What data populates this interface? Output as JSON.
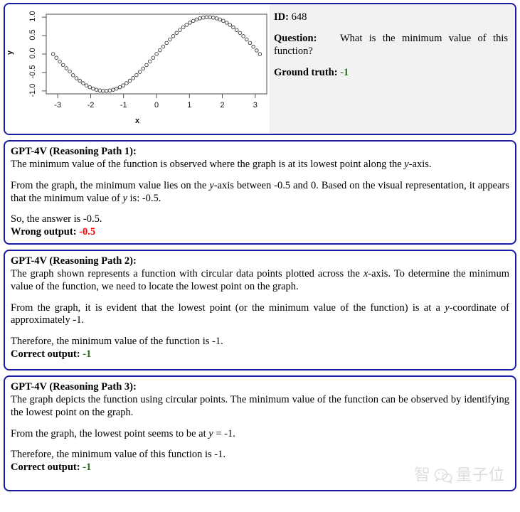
{
  "meta": {
    "id_label": "ID:",
    "id_value": "648",
    "question_label": "Question:",
    "question_text": "What is the minimum value of this function?",
    "ground_truth_label": "Ground truth:",
    "ground_truth_value": "-1",
    "ground_truth_color": "#2a6b18"
  },
  "chart_data": {
    "type": "scatter",
    "title": "",
    "xlabel": "x",
    "ylabel": "y",
    "xlim": [
      -3.35,
      3.35
    ],
    "ylim": [
      -1.08,
      1.08
    ],
    "grid": false,
    "legend": null,
    "marker": "open-circle",
    "xticks": [
      "-3",
      "-2",
      "-1",
      "0",
      "1",
      "2",
      "3"
    ],
    "xtick_values": [
      -3,
      -2,
      -1,
      0,
      1,
      2,
      3
    ],
    "yticks": [
      "1.0",
      "0.5",
      "0.0",
      "-0.5",
      "-1.0"
    ],
    "ytick_values": [
      1.0,
      0.5,
      0.0,
      -0.5,
      -1.0
    ],
    "function": "y = sin(x)",
    "n_points": 63,
    "x": [
      -3.1416,
      -3.0402,
      -2.9388,
      -2.8374,
      -2.736,
      -2.6346,
      -2.5332,
      -2.4318,
      -2.3304,
      -2.229,
      -2.1276,
      -2.0262,
      -1.9248,
      -1.8234,
      -1.722,
      -1.6206,
      -1.5192,
      -1.4178,
      -1.3164,
      -1.215,
      -1.1136,
      -1.0122,
      -0.9108,
      -0.8094,
      -0.708,
      -0.6066,
      -0.5052,
      -0.4038,
      -0.3024,
      -0.201,
      -0.0996,
      0.0018,
      0.1032,
      0.2046,
      0.306,
      0.4074,
      0.5088,
      0.6102,
      0.7116,
      0.813,
      0.9144,
      1.0158,
      1.1172,
      1.2186,
      1.32,
      1.4214,
      1.5228,
      1.6242,
      1.7256,
      1.827,
      1.9284,
      2.0298,
      2.1312,
      2.2326,
      2.334,
      2.4354,
      2.5368,
      2.6382,
      2.7396,
      2.841,
      2.9424,
      3.0438,
      3.1416
    ],
    "y": [
      0.0,
      -0.1011,
      -0.2013,
      -0.2955,
      -0.3853,
      -0.4713,
      -0.5747,
      -0.6561,
      -0.7243,
      -0.7918,
      -0.8504,
      -0.8994,
      -0.9386,
      -0.9682,
      -0.9885,
      -0.9987,
      -0.9985,
      -0.9884,
      -0.9684,
      -0.9386,
      -0.8997,
      -0.8508,
      -0.7899,
      -0.7242,
      -0.6504,
      -0.5697,
      -0.4837,
      -0.3929,
      -0.2978,
      -0.1996,
      -0.0994,
      0.0018,
      0.103,
      0.2032,
      0.3012,
      0.3962,
      0.4868,
      0.5728,
      0.6531,
      0.7267,
      0.7925,
      0.8499,
      0.8989,
      0.938,
      0.9687,
      0.9887,
      0.9992,
      0.9983,
      0.9877,
      0.9674,
      0.9375,
      0.8988,
      0.8494,
      0.7919,
      0.7246,
      0.6513,
      0.5716,
      0.4854,
      0.3952,
      0.3007,
      0.1993,
      0.0978,
      0.0
    ]
  },
  "paths": [
    {
      "title": "GPT-4V (Reasoning Path 1):",
      "para1_a": "The minimum value of the function is observed where the graph is at its lowest point along the ",
      "para1_math": "y",
      "para1_b": "-axis.",
      "para2_a": "From the graph, the minimum value lies on the ",
      "para2_math": "y",
      "para2_b": "-axis between -0.5 and 0. Based on the visual representation, it appears that the minimum value of ",
      "para2_math2": "y",
      "para2_c": " is: -0.5.",
      "para3": "So, the answer is -0.5.",
      "verdict_label": "Wrong output:",
      "verdict_value": "-0.5",
      "verdict_color": "#ff0000"
    },
    {
      "title": "GPT-4V (Reasoning Path 2):",
      "para1_a": "The graph shown represents a function with circular data points plotted across the ",
      "para1_math": "x",
      "para1_b": "-axis. To determine the minimum value of the function, we need to locate the lowest point on the graph.",
      "para2_a": "From the graph, it is evident that the lowest point (or the minimum value of the function) is at a ",
      "para2_math": "y",
      "para2_b": "-coordinate of approximately -1.",
      "para3": "Therefore, the minimum value of the function is -1.",
      "verdict_label": "Correct output:",
      "verdict_value": "-1",
      "verdict_color": "#2a6b18"
    },
    {
      "title": "GPT-4V (Reasoning Path 3):",
      "para1_a": "The graph depicts the function using circular points.  The minimum value of the function can be observed by identifying the lowest point on the graph.",
      "para1_math": "",
      "para1_b": "",
      "para2_a": "From the graph, the lowest point seems to be at ",
      "para2_math": "y",
      "para2_b": " = -1.",
      "para3": "Therefore, the minimum value of this function is -1.",
      "verdict_label": "Correct output:",
      "verdict_value": "-1",
      "verdict_color": "#2a6b18"
    }
  ],
  "watermark": {
    "glyph": "智",
    "text": "量子位"
  }
}
